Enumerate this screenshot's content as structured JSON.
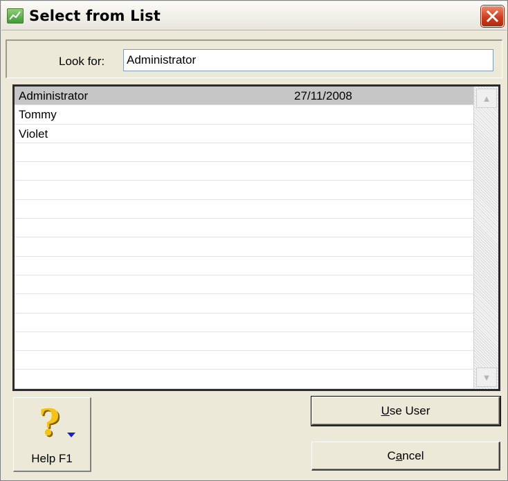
{
  "window": {
    "title": "Select from List",
    "icon": "app-chart-icon",
    "close_icon": "close-icon",
    "accent_color": "#c9401f"
  },
  "search": {
    "label": "Look for:",
    "value": "Administrator"
  },
  "list": {
    "rows": [
      {
        "name": "Administrator",
        "date": "27/11/2008",
        "selected": true
      },
      {
        "name": "Tommy",
        "date": ""
      },
      {
        "name": "Violet",
        "date": ""
      },
      {
        "name": "",
        "date": ""
      },
      {
        "name": "",
        "date": ""
      },
      {
        "name": "",
        "date": ""
      },
      {
        "name": "",
        "date": ""
      },
      {
        "name": "",
        "date": ""
      },
      {
        "name": "",
        "date": ""
      },
      {
        "name": "",
        "date": ""
      },
      {
        "name": "",
        "date": ""
      },
      {
        "name": "",
        "date": ""
      },
      {
        "name": "",
        "date": ""
      },
      {
        "name": "",
        "date": ""
      },
      {
        "name": "",
        "date": ""
      },
      {
        "name": "",
        "date": ""
      }
    ],
    "selected_color": "#c6c6c6"
  },
  "buttons": {
    "help": {
      "label": "Help F1",
      "icon": "question-mark-icon"
    },
    "use_user": {
      "mnemonic": "U",
      "rest": "se User"
    },
    "cancel": {
      "pre": "C",
      "mnemonic": "a",
      "rest": "ncel"
    }
  }
}
